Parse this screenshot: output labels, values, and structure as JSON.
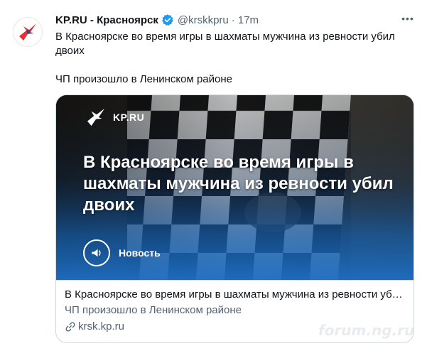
{
  "tweet": {
    "author_name": "KP.RU - Красноярск",
    "handle": "@krskkpru",
    "separator": "·",
    "time": "17m",
    "text_line1": "В Красноярске во время игры в шахматы мужчина из ревности убил двоих",
    "text_line2": "ЧП произошло в Ленинском районе",
    "more_label": "•••"
  },
  "card": {
    "logo_text": "KP.RU",
    "headline": "В Красноярске во время игры в шахматы мужчина из ревности убил двоих",
    "badge_label": "Новость",
    "title": "В Красноярске во время игры в шахматы мужчина из ревности уби...",
    "description": "ЧП произошло в Ленинском районе",
    "link": "krsk.kp.ru"
  },
  "watermark": "forum.ng.ru",
  "colors": {
    "text_primary": "#0f1419",
    "text_secondary": "#536471",
    "verified_blue": "#1d9bf0",
    "border": "#cfd9de",
    "card_overlay_blue": "#1e6fc4",
    "logo_red": "#e8312f"
  },
  "icons": {
    "avatar": "kp-bird-logo-icon",
    "verified": "verified-badge-icon",
    "more": "more-dots-icon",
    "badge": "megaphone-icon",
    "link": "link-icon"
  }
}
